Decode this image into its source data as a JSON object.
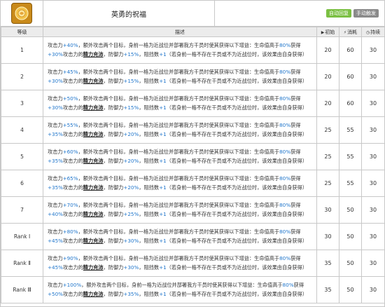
{
  "skill": {
    "icon": "rose-sun-icon",
    "name": "英勇的祝福",
    "tags": [
      "自动回复",
      "手动触发"
    ]
  },
  "headers": {
    "level": "等级",
    "desc": "描述",
    "init": "初始",
    "cost": "消耗",
    "dur": "持续"
  },
  "text": {
    "atk_label": "攻击力",
    "extra_targets": "，额外攻击两个目标，身前一格为近战位并部署我方干员时使其获得以下增益：生命值高于",
    "hp_threshold": "80%",
    "gain": "获得",
    "of_atk": "攻击力的",
    "regen": "精力充沛",
    "def_label": "，防御力",
    "block_label": "，阻挡数",
    "block_value": "+1",
    "tail": "（若身前一格不存在干员或不为近战位时，该效果由自身获得）"
  },
  "rows": [
    {
      "level": "1",
      "atk": "+40%",
      "shield": "+30%",
      "def": "+15%",
      "init": "20",
      "cost": "60",
      "dur": "30"
    },
    {
      "level": "2",
      "atk": "+45%",
      "shield": "+30%",
      "def": "+15%",
      "init": "20",
      "cost": "60",
      "dur": "30"
    },
    {
      "level": "3",
      "atk": "+50%",
      "shield": "+30%",
      "def": "+15%",
      "init": "20",
      "cost": "60",
      "dur": "30"
    },
    {
      "level": "4",
      "atk": "+55%",
      "shield": "+35%",
      "def": "+20%",
      "init": "25",
      "cost": "55",
      "dur": "30"
    },
    {
      "level": "5",
      "atk": "+60%",
      "shield": "+35%",
      "def": "+20%",
      "init": "25",
      "cost": "55",
      "dur": "30"
    },
    {
      "level": "6",
      "atk": "+65%",
      "shield": "+35%",
      "def": "+20%",
      "init": "25",
      "cost": "55",
      "dur": "30"
    },
    {
      "level": "7",
      "atk": "+70%",
      "shield": "+40%",
      "def": "+25%",
      "init": "30",
      "cost": "50",
      "dur": "30"
    },
    {
      "level": "Rank Ⅰ",
      "atk": "+80%",
      "shield": "+45%",
      "def": "+30%",
      "init": "30",
      "cost": "50",
      "dur": "30"
    },
    {
      "level": "Rank Ⅱ",
      "atk": "+90%",
      "shield": "+45%",
      "def": "+30%",
      "init": "35",
      "cost": "50",
      "dur": "30"
    },
    {
      "level": "Rank Ⅲ",
      "atk": "+100%",
      "shield": "+50%",
      "def": "+35%",
      "init": "35",
      "cost": "50",
      "dur": "30"
    }
  ]
}
